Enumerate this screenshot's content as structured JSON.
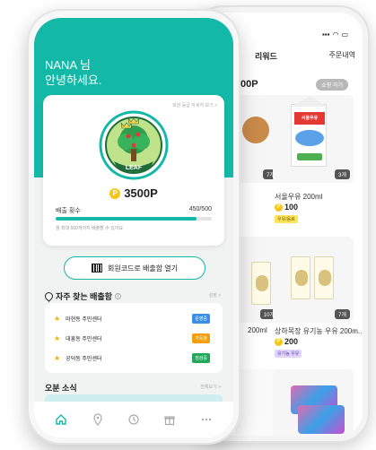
{
  "back_screen": {
    "tabs": [
      "리워드",
      "주문내역"
    ],
    "header": "00P",
    "pill": "쇼핑 하기",
    "products": [
      {
        "count": "7개"
      },
      {
        "count": "3개",
        "name": "서울우유 200ml",
        "price": "100",
        "tag": "우유/음료"
      },
      {
        "count": "10개",
        "name": "200ml"
      },
      {
        "count": "7개",
        "name": "상하목장 유기농 우유 200m...",
        "price": "200",
        "tag": "유기농 우유"
      }
    ]
  },
  "front_screen": {
    "greeting_line1": "NANA 님",
    "greeting_line2": "안녕하세요.",
    "card_link": "회원 등급 자세히 보기 >",
    "emblem_text": "LEAF",
    "points": "3500P",
    "row_label": "배출 횟수",
    "row_value": "450/500",
    "progress": 0.9,
    "progress_note": "월 최대 500개까지 배출할 수 있어요",
    "barcode_button": "회원코드로 배출함 열기",
    "section_title": "자주 찾는 배출함",
    "section_more": "설정 >",
    "centers": [
      {
        "name": "마현동 주민센터",
        "badge": "운영중",
        "color": "#3a8ee6"
      },
      {
        "name": "대흥동 주민센터",
        "badge": "가득참",
        "color": "#f59e0b"
      },
      {
        "name": "공덕동 주민센터",
        "badge": "점검중",
        "color": "#22a85a"
      }
    ],
    "news_title": "오분 소식",
    "news_more": "전체보기 >"
  },
  "nav_icons": [
    "home-icon",
    "location-icon",
    "history-icon",
    "gift-icon",
    "more-icon"
  ]
}
